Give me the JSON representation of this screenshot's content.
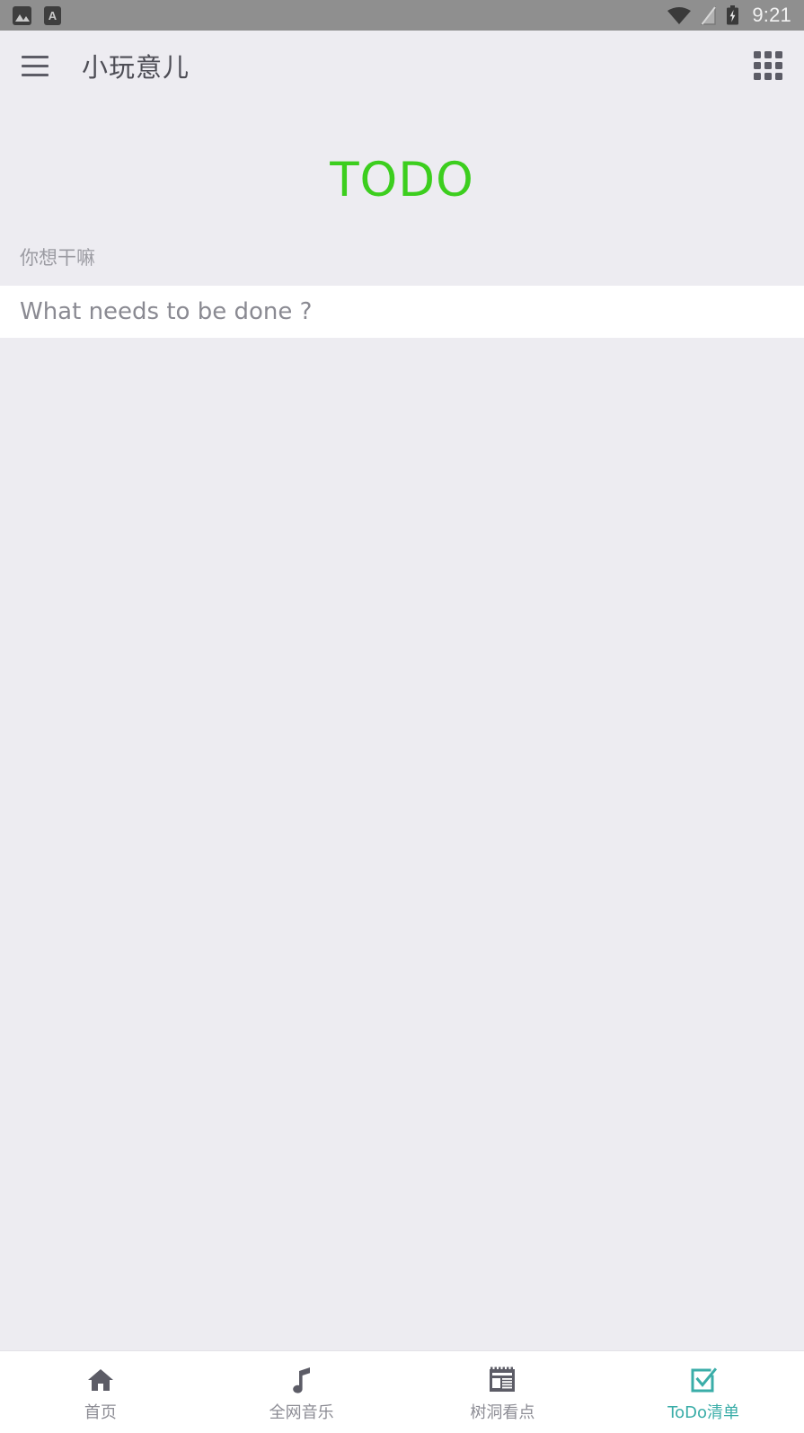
{
  "colors": {
    "statusbar_bg": "#8f8f8f",
    "page_bg": "#edecf1",
    "heading_green": "#3cce1e",
    "accent_teal": "#3aada8",
    "icon_gray": "#5c5c66",
    "label_gray": "#9b9ba2",
    "nav_gray": "#8d8d95",
    "input_bg": "#ffffff"
  },
  "statusbar": {
    "time": "9:21",
    "left_icons": [
      {
        "name": "photo-icon",
        "glyph": "image"
      },
      {
        "name": "app-a-icon",
        "glyph": "A"
      }
    ],
    "right_icons": [
      {
        "name": "wifi-icon"
      },
      {
        "name": "no-sim-icon"
      },
      {
        "name": "battery-charging-icon"
      }
    ]
  },
  "appbar": {
    "menu_icon": "hamburger-menu-icon",
    "title": "小玩意儿",
    "grid_icon": "apps-grid-icon"
  },
  "main": {
    "heading": "TODO",
    "field_label": "你想干嘛",
    "input": {
      "value": "",
      "placeholder": "What needs to be done ?"
    },
    "todo_items": []
  },
  "bottom_nav": {
    "active_index": 3,
    "items": [
      {
        "label": "首页",
        "icon": "home-icon",
        "active": false
      },
      {
        "label": "全网音乐",
        "icon": "music-note-icon",
        "active": false
      },
      {
        "label": "树洞看点",
        "icon": "newspaper-icon",
        "active": false
      },
      {
        "label": "ToDo清单",
        "icon": "checkbox-check-icon",
        "active": true
      }
    ]
  }
}
